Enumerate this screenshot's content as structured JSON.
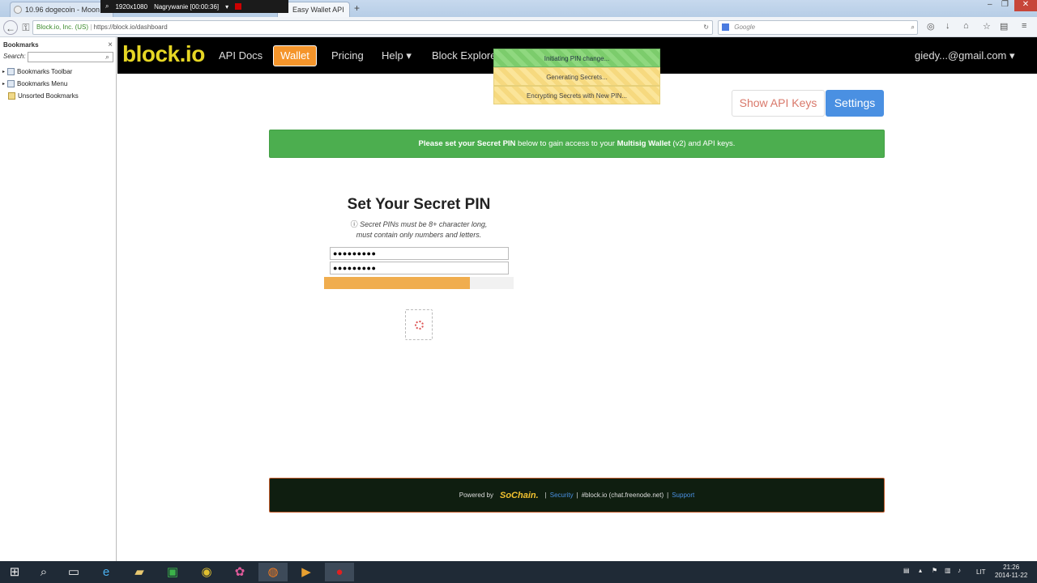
{
  "browser": {
    "tabs": [
      {
        "title": "10.96 dogecoin - Moon Do",
        "active": false
      },
      {
        "title": "Easy Wallet API",
        "active": true
      }
    ],
    "new_tab": "+",
    "recorder": {
      "resolution": "1920x1080",
      "status": "Nagrywanie [00:00:36]"
    },
    "url": {
      "identity": "Block.io, Inc. (US)",
      "address": "https://block.io/dashboard"
    },
    "search_placeholder": "Google"
  },
  "bookmarks_sidebar": {
    "title": "Bookmarks",
    "close": "×",
    "search_label": "Search:",
    "items": [
      "Bookmarks Toolbar",
      "Bookmarks Menu",
      "Unsorted Bookmarks"
    ]
  },
  "site_nav": {
    "logo": "block.io",
    "links": [
      "API Docs",
      "Wallet",
      "Pricing",
      "Help ▾",
      "Block Explorer"
    ],
    "account": "giedy...@gmail.com ▾"
  },
  "notifications": [
    "Initiating PIN change...",
    "Generating Secrets...",
    "Encrypting Secrets with New PIN..."
  ],
  "buttons": {
    "api_keys": "Show API Keys",
    "settings": "Settings"
  },
  "alert": {
    "part1": "Please set your Secret PIN",
    "part2": " below to gain access to your ",
    "part3": "Multisig Wallet",
    "part4": " (v2) and API keys."
  },
  "pin_form": {
    "title": "Set Your Secret PIN",
    "note_line1": "Secret PINs must be 8+ character long,",
    "note_line2": "must contain only numbers and letters.",
    "pin_value": "●●●●●●●●●",
    "confirm_value": "●●●●●●●●●",
    "progress": 0.77
  },
  "footer": {
    "powered_by": "Powered by",
    "brand": "SoChain.",
    "security": "Security",
    "irc": "#block.io (chat.freenode.net)",
    "support": "Support",
    "sep": "|"
  },
  "taskbar": {
    "lang": "LIT",
    "time": "21:26",
    "date": "2014-11-22"
  },
  "colors": {
    "accent": "#f5952b",
    "logo": "#e6d624",
    "success": "#4cae4f",
    "primary": "#4a90e2"
  }
}
